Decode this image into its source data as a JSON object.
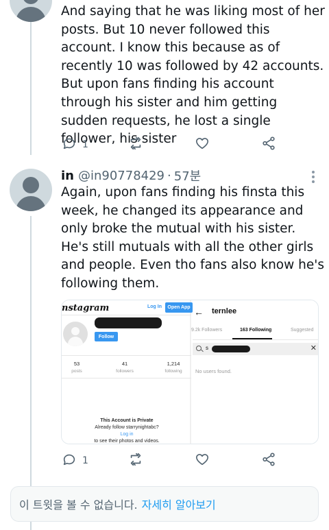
{
  "tweet1": {
    "text": "And saying that he was liking most of her posts. But 10 never followed this account. I know this because as of recently 10 was followed by 42 accounts. But upon fans finding his account through his sister and him getting sudden requests, he lost a single follower, his sister",
    "reply_count": "1"
  },
  "tweet2": {
    "display_name": "in",
    "handle": "@in90778429",
    "separator": "·",
    "time": "57분",
    "text": "Again, upon fans finding his finsta this week, he changed its appearance and only broke the mutual with his sister. He's still mutuals with all the other girls and people. Even tho fans also know he's following them.",
    "reply_count": "1",
    "media": {
      "instagram": {
        "logo_text": "nstagram",
        "login_label": "Log In",
        "open_app_label": "Open App",
        "follow_label": "Follow",
        "stats": [
          {
            "value": "53",
            "label": "posts"
          },
          {
            "value": "41",
            "label": "followers"
          },
          {
            "value": "1,214",
            "label": "following"
          }
        ],
        "private_title": "This Account is Private",
        "private_line1": "Already follow starrynightabc?",
        "private_login": "Log in",
        "private_line2": "to see their photos and videos."
      },
      "following_list": {
        "back_arrow": "←",
        "username": "ternlee",
        "tabs": [
          "9.2k Followers",
          "163 Following",
          "Suggested"
        ],
        "active_tab": "163 Following",
        "search_value": "s",
        "clear_icon": "✕",
        "empty_text": "No users found."
      }
    }
  },
  "unavailable": {
    "message": "이 트윗을 볼 수 없습니다.",
    "learn_more": "자세히 알아보기"
  },
  "colors": {
    "text": "#0f1419",
    "secondary": "#536471",
    "link": "#1d9bf0",
    "thread_line": "#cfd9de"
  },
  "icons": [
    "reply-icon",
    "retweet-icon",
    "like-icon",
    "share-icon",
    "more-icon"
  ]
}
